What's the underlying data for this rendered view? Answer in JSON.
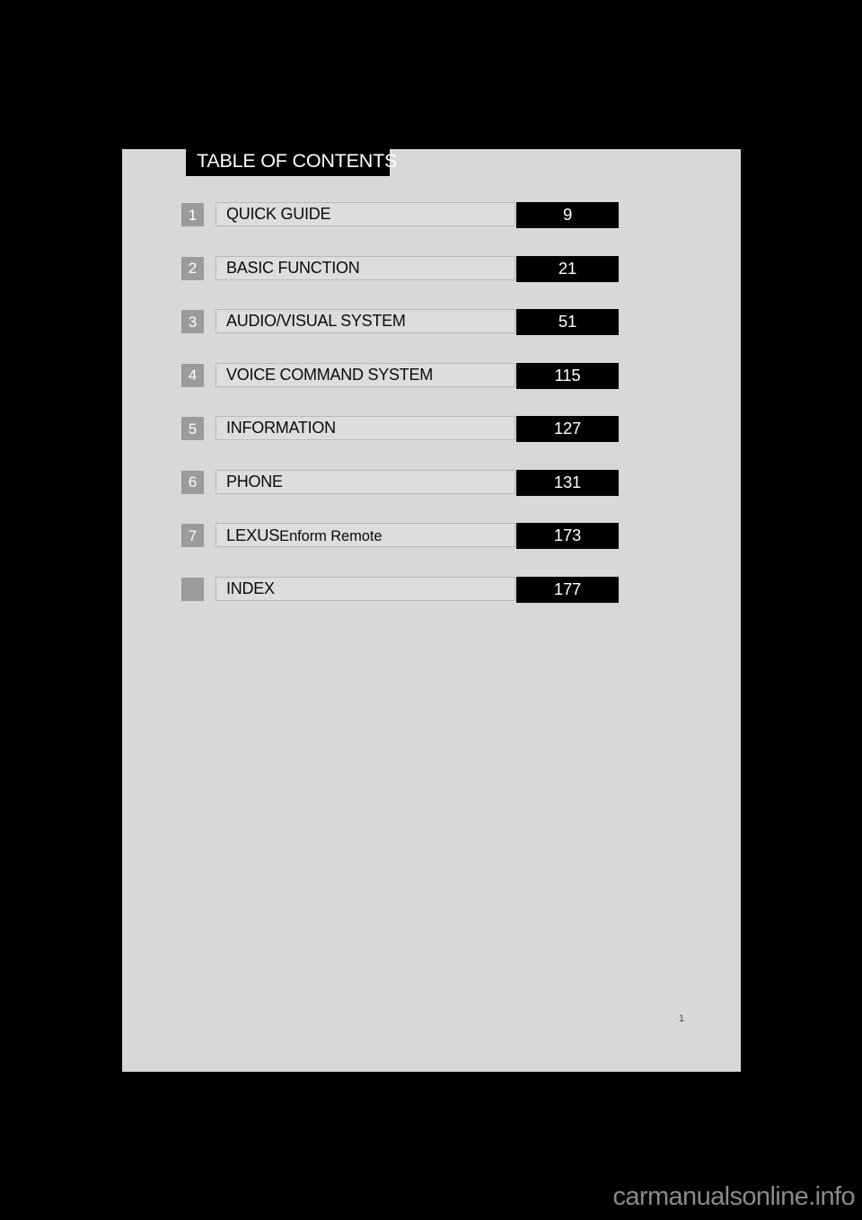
{
  "page": {
    "background_color": "#000000",
    "sheet_color": "#d8d8d8",
    "folio": "1"
  },
  "heading": {
    "text": "TABLE OF CONTENTS",
    "background_color": "#000000",
    "text_color": "#ffffff"
  },
  "contents": {
    "chip_color": "#9b9b9b",
    "plate_color": "#dddddd",
    "page_plate_color": "#000000",
    "rows": [
      {
        "chapter": "1",
        "title": "QUICK GUIDE",
        "page": "9"
      },
      {
        "chapter": "2",
        "title": "BASIC FUNCTION",
        "page": "21"
      },
      {
        "chapter": "3",
        "title": "AUDIO/VISUAL SYSTEM",
        "page": "51"
      },
      {
        "chapter": "4",
        "title": "VOICE COMMAND SYSTEM",
        "page": "115"
      },
      {
        "chapter": "5",
        "title": "INFORMATION",
        "page": "127"
      },
      {
        "chapter": "6",
        "title": "PHONE",
        "page": "131"
      },
      {
        "chapter": "7",
        "title": "LEXUS Enform Remote",
        "brand_caps": "LEXUS",
        "brand_mixed": "Enform Remote",
        "page": "173"
      },
      {
        "chapter": "",
        "title": "INDEX",
        "page": "177"
      }
    ]
  },
  "watermark": {
    "text": "carmanualsonline.info"
  }
}
